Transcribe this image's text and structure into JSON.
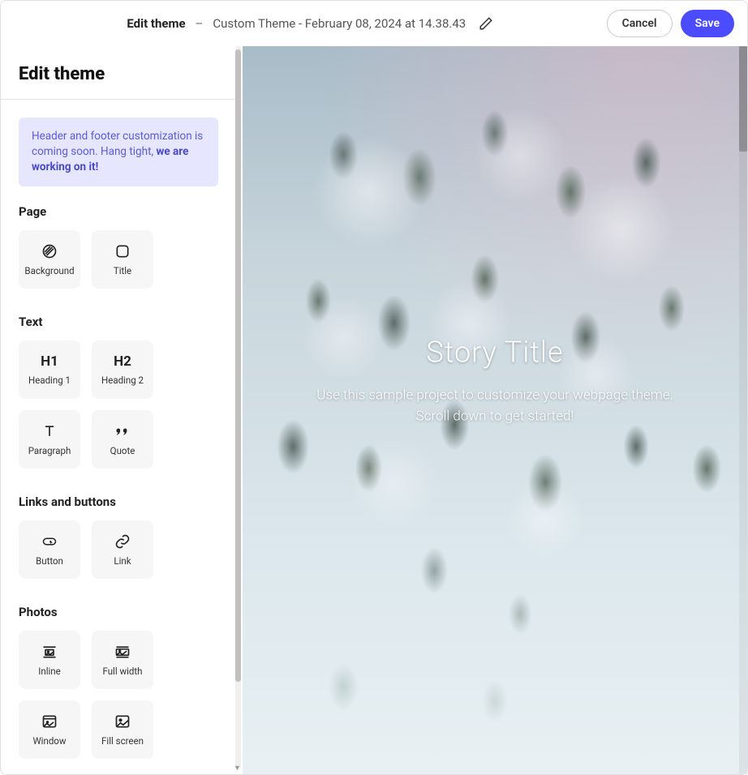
{
  "header": {
    "title": "Edit theme",
    "subtitle": "Custom Theme - February 08, 2024 at 14.38.43",
    "cancel_label": "Cancel",
    "save_label": "Save"
  },
  "sidebar": {
    "title": "Edit theme",
    "notice": {
      "text": "Header and footer customization is coming soon. Hang tight, ",
      "bold": "we are working on it!"
    },
    "sections": [
      {
        "title": "Page",
        "tiles": [
          {
            "label": "Background",
            "icon": "hatch-icon"
          },
          {
            "label": "Title",
            "icon": "title-icon"
          }
        ]
      },
      {
        "title": "Text",
        "tiles": [
          {
            "label": "Heading 1",
            "icon_text": "H1"
          },
          {
            "label": "Heading 2",
            "icon_text": "H2"
          },
          {
            "label": "Paragraph",
            "icon": "text-icon"
          },
          {
            "label": "Quote",
            "icon": "quote-icon"
          }
        ]
      },
      {
        "title": "Links and buttons",
        "tiles": [
          {
            "label": "Button",
            "icon": "button-icon"
          },
          {
            "label": "Link",
            "icon": "link-icon"
          }
        ]
      },
      {
        "title": "Photos",
        "tiles": [
          {
            "label": "Inline",
            "icon": "inline-icon"
          },
          {
            "label": "Full width",
            "icon": "fullwidth-icon"
          },
          {
            "label": "Window",
            "icon": "window-icon"
          },
          {
            "label": "Fill screen",
            "icon": "fillscreen-icon"
          }
        ]
      }
    ]
  },
  "preview": {
    "title": "Story Title",
    "description_line1": "Use this sample project to customize your webpage theme.",
    "description_line2": "Scroll down to get started!"
  }
}
